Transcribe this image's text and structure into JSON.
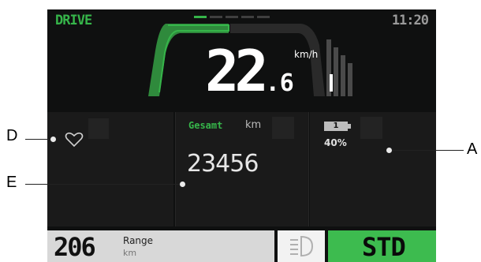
{
  "header": {
    "mode_label": "DRIVE",
    "time": "11:20",
    "page_indicator": {
      "count": 5,
      "active": 0
    }
  },
  "speedometer": {
    "speed_integer": "22",
    "speed_decimal": ".6",
    "unit": "km/h"
  },
  "panels": {
    "left": {
      "icon": "heart-icon"
    },
    "center": {
      "label": "Gesamt",
      "unit": "km",
      "value": "23456"
    },
    "right": {
      "battery_level": "1",
      "battery_percent": "40%",
      "icon": "battery-icon"
    }
  },
  "bottom_bar": {
    "range_value": "206",
    "range_label": "Range",
    "range_unit": "km",
    "light_icon": "headlight-icon",
    "ride_mode": "STD"
  },
  "callouts": {
    "a": "A",
    "d": "D",
    "e": "E"
  },
  "colors": {
    "accent_green": "#36b54a",
    "mode_green": "#3dbb4f",
    "screen_bg": "#0f1010"
  }
}
